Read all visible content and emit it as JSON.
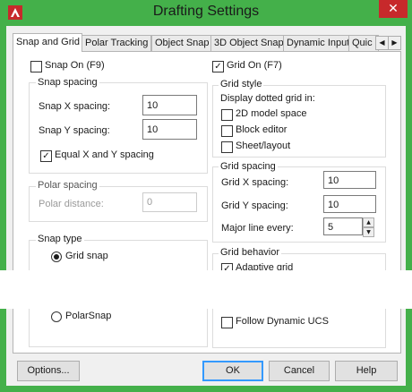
{
  "window": {
    "title": "Drafting Settings",
    "close_glyph": "✕"
  },
  "tabs": [
    {
      "label": "Snap and Grid"
    },
    {
      "label": "Polar Tracking"
    },
    {
      "label": "Object Snap"
    },
    {
      "label": "3D Object Snap"
    },
    {
      "label": "Dynamic Input"
    },
    {
      "label": "Quic"
    }
  ],
  "tab_scroll": {
    "left": "◀",
    "right": "▶"
  },
  "snap": {
    "on_label": "Snap On (F9)",
    "spacing_title": "Snap spacing",
    "x_label": "Snap X spacing:",
    "x_value": "10",
    "y_label": "Snap Y spacing:",
    "y_value": "10",
    "equal_label": "Equal X and Y spacing",
    "polar_title": "Polar spacing",
    "polar_label": "Polar distance:",
    "polar_value": "0",
    "type_title": "Snap type",
    "grid_snap_label": "Grid snap",
    "polarsnap_label": "PolarSnap"
  },
  "grid": {
    "on_label": "Grid On (F7)",
    "style_title": "Grid style",
    "dotted_label": "Display dotted grid in:",
    "model_label": "2D model space",
    "block_label": "Block editor",
    "sheet_label": "Sheet/layout",
    "spacing_title": "Grid spacing",
    "x_label": "Grid X spacing:",
    "x_value": "10",
    "y_label": "Grid Y spacing:",
    "y_value": "10",
    "major_label": "Major line every:",
    "major_value": "5",
    "behavior_title": "Grid behavior",
    "adaptive_label": "Adaptive grid",
    "follow_ucs_label": "Follow Dynamic UCS"
  },
  "buttons": {
    "options": "Options...",
    "ok": "OK",
    "cancel": "Cancel",
    "help": "Help"
  },
  "check_glyph": "✓",
  "colors": {
    "title_bar": "#44b04a",
    "close_button": "#c7292b",
    "focus_border": "#3399ff"
  },
  "icons": {
    "app": "autocad-a-icon",
    "close": "close-icon"
  }
}
